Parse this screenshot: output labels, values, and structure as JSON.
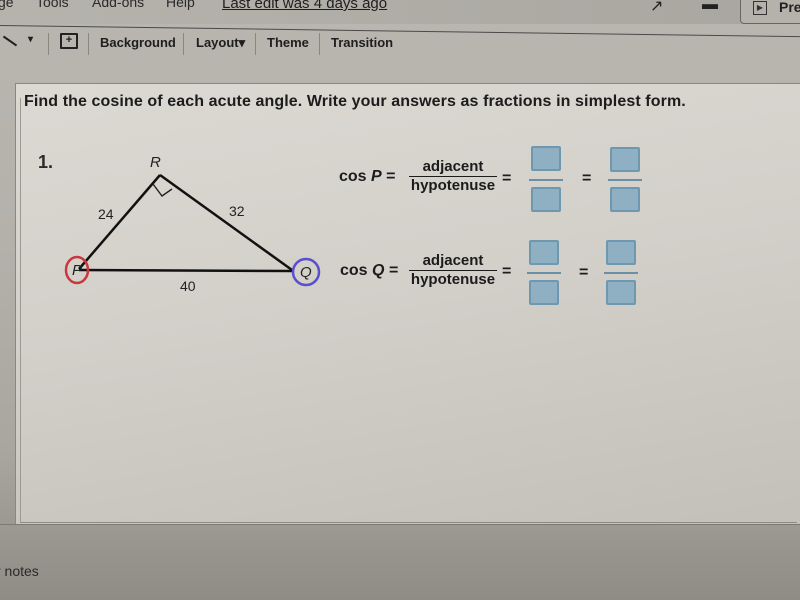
{
  "menubar": {
    "items": [
      "ge",
      "Tools",
      "Add-ons",
      "Help"
    ],
    "last_edit": "Last edit was 4 days ago",
    "present_label": "Pre"
  },
  "toolbar": {
    "background_label": "Background",
    "layout_label": "Layout",
    "layout_caret": "▾",
    "theme_label": "Theme",
    "transition_label": "Transition",
    "line_caret": "▾",
    "comment_glyph": "+"
  },
  "slide": {
    "instruction": "Find the  cosine of each acute angle. Write your answers as fractions in simplest form.",
    "problem_number": "1.",
    "triangle": {
      "vertices": {
        "P": "P",
        "Q": "Q",
        "R": "R"
      },
      "side_PR": "24",
      "side_RQ": "32",
      "side_PQ": "40",
      "right_angle_at": "R",
      "circle_P_color": "#c8383c",
      "circle_Q_color": "#5a4fd0"
    },
    "equations": [
      {
        "func": "cos",
        "angle": "P",
        "equals": "=",
        "numerator": "adjacent",
        "denominator": "hypotenuse",
        "answer_boxes": [
          {
            "numerator": "",
            "denominator": ""
          },
          {
            "numerator": "",
            "denominator": ""
          }
        ]
      },
      {
        "func": "cos",
        "angle": "Q",
        "equals": "=",
        "numerator": "adjacent",
        "denominator": "hypotenuse",
        "answer_boxes": [
          {
            "numerator": "",
            "denominator": ""
          },
          {
            "numerator": "",
            "denominator": ""
          }
        ]
      }
    ],
    "box_color": "#8fb0c2"
  },
  "notes": {
    "label": "r notes"
  }
}
